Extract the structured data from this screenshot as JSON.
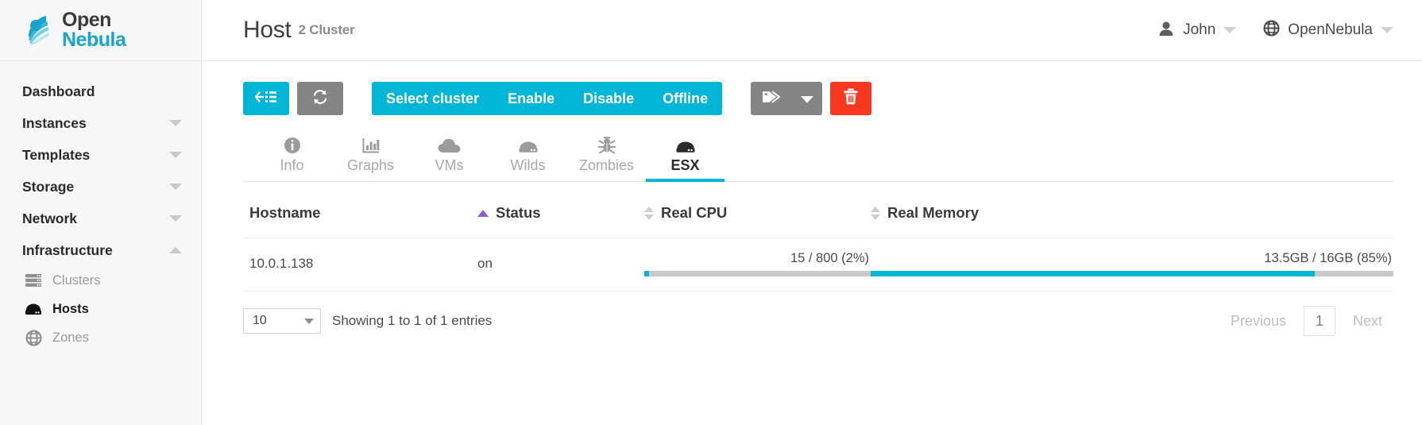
{
  "brand": {
    "name_part1": "Open",
    "name_part2": "Nebula",
    "accent_color": "#1aa3cf"
  },
  "sidebar": {
    "items": [
      {
        "label": "Dashboard",
        "caret": "none"
      },
      {
        "label": "Instances",
        "caret": "down"
      },
      {
        "label": "Templates",
        "caret": "down"
      },
      {
        "label": "Storage",
        "caret": "down"
      },
      {
        "label": "Network",
        "caret": "down"
      },
      {
        "label": "Infrastructure",
        "caret": "up"
      }
    ],
    "sub_items": [
      {
        "label": "Clusters",
        "icon": "servers-icon",
        "active": false
      },
      {
        "label": "Hosts",
        "icon": "host-icon",
        "active": true
      },
      {
        "label": "Zones",
        "icon": "globe-icon",
        "active": false
      }
    ]
  },
  "header": {
    "title": "Host",
    "subtitle": "2 Cluster",
    "user": "John",
    "zone": "OpenNebula"
  },
  "toolbar": {
    "back_icon": "back-list-icon",
    "refresh_icon": "refresh-icon",
    "select_cluster": "Select cluster",
    "enable": "Enable",
    "disable": "Disable",
    "offline": "Offline",
    "tag_icon": "tag-icon",
    "tag_caret_icon": "chevron-down-icon",
    "delete_icon": "trash-icon",
    "colors": {
      "primary": "#00b5d6",
      "secondary": "#848484",
      "danger": "#f8391f"
    }
  },
  "tabs": [
    {
      "label": "Info",
      "icon": "info-icon",
      "active": false
    },
    {
      "label": "Graphs",
      "icon": "chart-bar-icon",
      "active": false
    },
    {
      "label": "VMs",
      "icon": "cloud-icon",
      "active": false
    },
    {
      "label": "Wilds",
      "icon": "server-icon",
      "active": false
    },
    {
      "label": "Zombies",
      "icon": "bug-icon",
      "active": false
    },
    {
      "label": "ESX",
      "icon": "host-icon",
      "active": true
    }
  ],
  "table": {
    "columns": [
      {
        "label": "Hostname",
        "sort": "none"
      },
      {
        "label": "Status",
        "sort": "asc"
      },
      {
        "label": "Real CPU",
        "sort": "both"
      },
      {
        "label": "Real Memory",
        "sort": "both"
      }
    ],
    "rows": [
      {
        "hostname": "10.0.1.138",
        "status": "on",
        "cpu_label": "15 / 800 (2%)",
        "cpu_percent": 2,
        "memory_label": "13.5GB / 16GB (85%)",
        "memory_percent": 85
      }
    ]
  },
  "footer": {
    "page_length": "10",
    "showing": "Showing 1 to 1 of 1 entries",
    "previous": "Previous",
    "page_number": "1",
    "next": "Next"
  }
}
